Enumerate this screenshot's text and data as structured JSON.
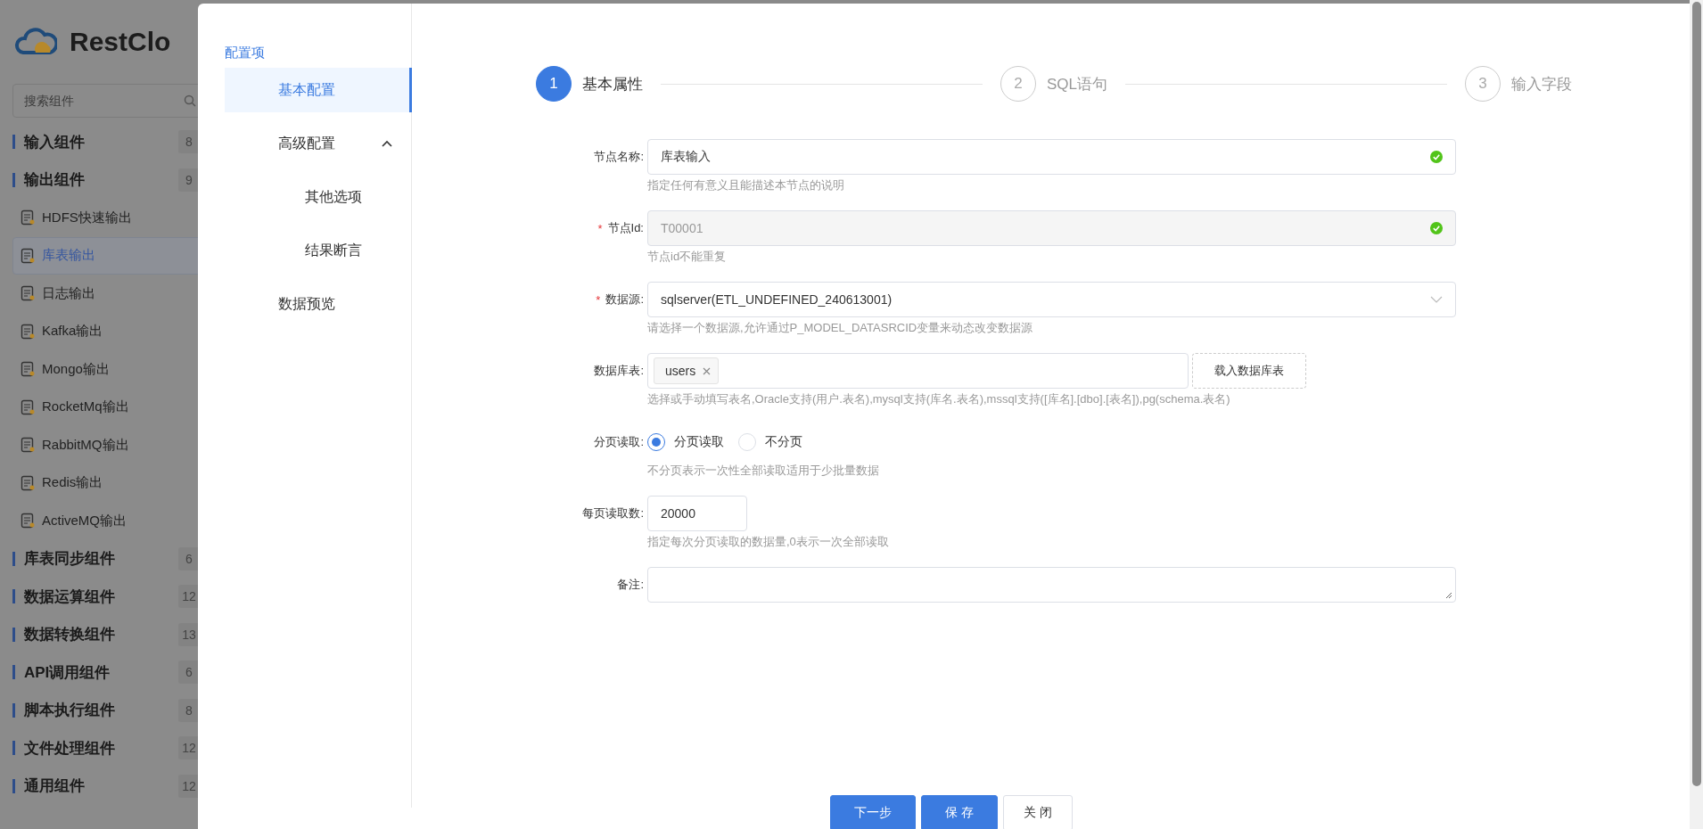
{
  "sidebar": {
    "logo_text": "RestClo",
    "search": {
      "placeholder": "搜索组件"
    },
    "groups": [
      {
        "name": "输入组件",
        "count": "8"
      },
      {
        "name": "输出组件",
        "count": "9",
        "children": [
          {
            "name": "HDFS快速输出",
            "selected": false
          },
          {
            "name": "库表输出",
            "selected": true
          },
          {
            "name": "日志输出",
            "selected": false
          },
          {
            "name": "Kafka输出",
            "selected": false
          },
          {
            "name": "Mongo输出",
            "selected": false
          },
          {
            "name": "RocketMq输出",
            "selected": false
          },
          {
            "name": "RabbitMQ输出",
            "selected": false
          },
          {
            "name": "Redis输出",
            "selected": false
          },
          {
            "name": "ActiveMQ输出",
            "selected": false
          }
        ]
      },
      {
        "name": "库表同步组件",
        "count": "6"
      },
      {
        "name": "数据运算组件",
        "count": "12"
      },
      {
        "name": "数据转换组件",
        "count": "13"
      },
      {
        "name": "API调用组件",
        "count": "6"
      },
      {
        "name": "脚本执行组件",
        "count": "8"
      },
      {
        "name": "文件处理组件",
        "count": "12"
      },
      {
        "name": "通用组件",
        "count": "12"
      }
    ]
  },
  "config_nav": {
    "title": "配置项",
    "items": [
      {
        "label": "基本配置",
        "selected": true
      },
      {
        "label": "高级配置",
        "selected": false,
        "expanded": true,
        "children": [
          {
            "label": "其他选项",
            "selected": false
          },
          {
            "label": "结果断言",
            "selected": false
          }
        ]
      },
      {
        "label": "数据预览",
        "selected": false
      }
    ]
  },
  "steps": [
    {
      "number": "1",
      "label": "基本属性",
      "active": true
    },
    {
      "number": "2",
      "label": "SQL语句",
      "active": false
    },
    {
      "number": "3",
      "label": "输入字段",
      "active": false
    }
  ],
  "form": [
    {
      "kind": "text",
      "label": "节点名称:",
      "value": "库表输入",
      "valid": true,
      "disabled": false,
      "hint": "指定任何有意义且能描述本节点的说明"
    },
    {
      "kind": "text",
      "label": "节点Id:",
      "required_mark": "*",
      "value": "T00001",
      "valid": true,
      "disabled": true,
      "hint": "节点id不能重复"
    },
    {
      "kind": "select",
      "label": "数据源:",
      "required_mark": "*",
      "value": "sqlserver(ETL_UNDEFINED_240613001)",
      "hint": "请选择一个数据源,允许通过P_MODEL_DATASRCID变量来动态改变数据源"
    },
    {
      "kind": "tags",
      "label": "数据库表:",
      "tags": [
        "users"
      ],
      "button": "载入数据库表",
      "hint": "选择或手动填写表名,Oracle支持(用户.表名),mysql支持(库名.表名),mssql支持([库名].[dbo].[表名]),pg(schema.表名)"
    },
    {
      "kind": "radio",
      "label": "分页读取:",
      "options": [
        {
          "label": "分页读取",
          "selected": true
        },
        {
          "label": "不分页",
          "selected": false
        }
      ],
      "hint": "不分页表示一次性全部读取适用于少批量数据"
    },
    {
      "kind": "number",
      "label": "每页读取数:",
      "value": "20000",
      "hint": "指定每次分页读取的数据量,0表示一次全部读取"
    },
    {
      "kind": "textarea",
      "label": "备注:"
    }
  ],
  "buttons": [
    {
      "label": "下一步",
      "kind": "primary"
    },
    {
      "label": "保 存",
      "kind": "primary"
    },
    {
      "label": "关 闭",
      "kind": "default"
    }
  ]
}
